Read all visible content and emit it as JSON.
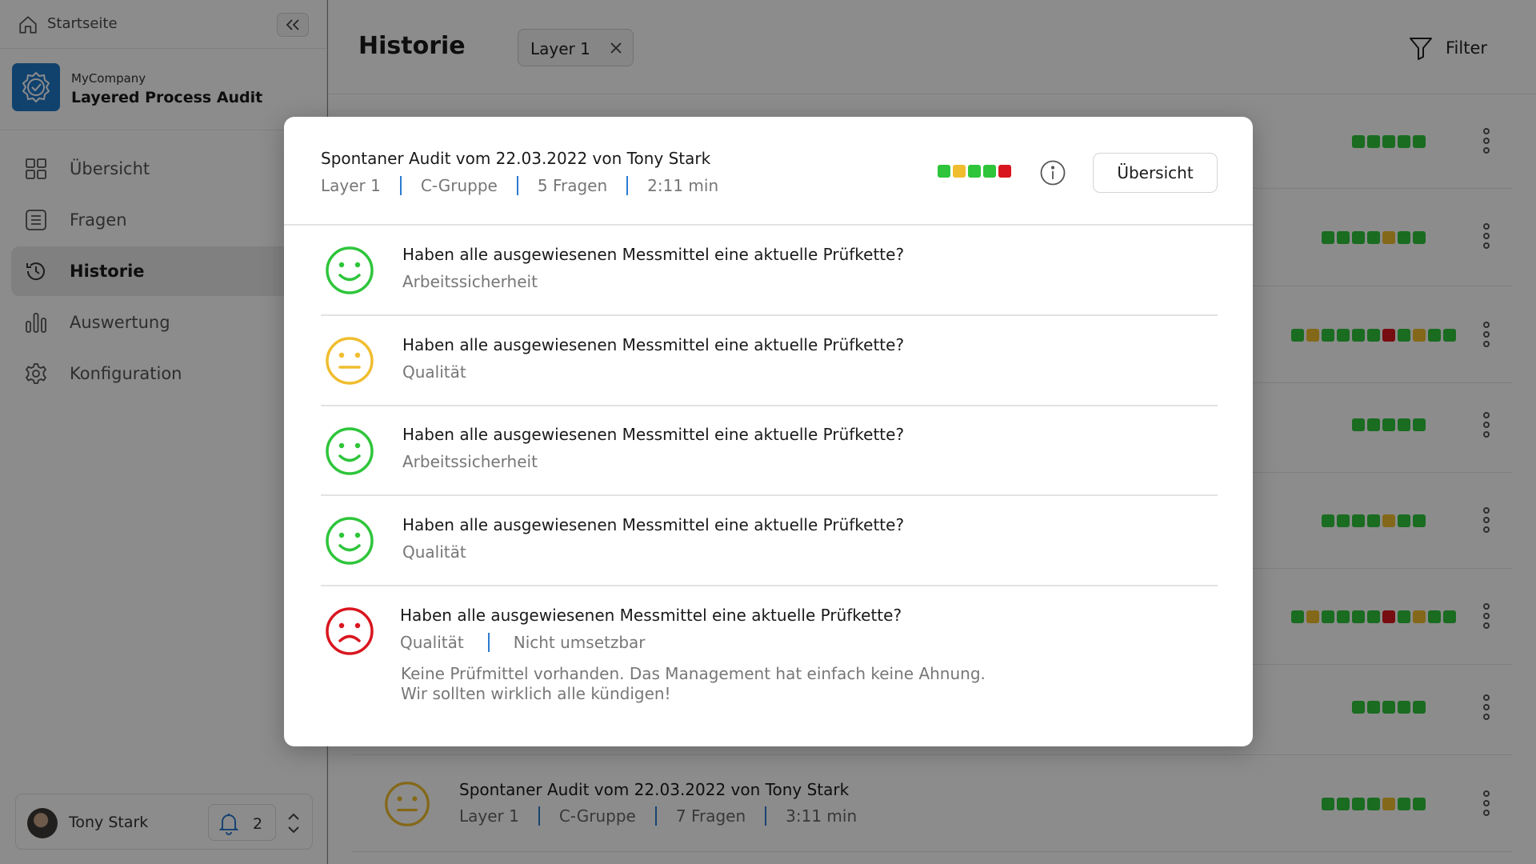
{
  "colors": {
    "green": "#2ec53b",
    "yellow": "#f0bd2f",
    "red": "#d9161f",
    "accent_blue": "#2b7bd0",
    "overlay": "rgba(0,0,0,0.45)"
  },
  "sidebar": {
    "home_label": "Startseite",
    "company": "MyCompany",
    "app_name": "Layered Process Audit",
    "nav": [
      {
        "label": "Übersicht",
        "icon": "grid-icon",
        "active": false
      },
      {
        "label": "Fragen",
        "icon": "list-icon",
        "active": false
      },
      {
        "label": "Historie",
        "icon": "history-icon",
        "active": true
      },
      {
        "label": "Auswertung",
        "icon": "bar-chart-icon",
        "active": false
      },
      {
        "label": "Konfiguration",
        "icon": "gear-icon",
        "active": false
      }
    ],
    "user": {
      "name": "Tony Stark",
      "notifications": "2"
    }
  },
  "header": {
    "title": "Historie",
    "chip_label": "Layer 1",
    "filter_label": "Filter"
  },
  "list": {
    "rows": [
      {
        "dots": [
          "green",
          "green",
          "green",
          "green",
          "green"
        ]
      },
      {
        "dots": [
          "green",
          "green",
          "green",
          "green",
          "yellow",
          "green",
          "green"
        ]
      },
      {
        "dots": [
          "green",
          "yellow",
          "green",
          "green",
          "green",
          "green",
          "red",
          "green",
          "yellow",
          "green",
          "green"
        ]
      },
      {
        "dots": [
          "green",
          "green",
          "green",
          "green",
          "green"
        ]
      },
      {
        "dots": [
          "green",
          "green",
          "green",
          "green",
          "yellow",
          "green",
          "green"
        ]
      },
      {
        "dots": [
          "green",
          "yellow",
          "green",
          "green",
          "green",
          "green",
          "red",
          "green",
          "yellow",
          "green",
          "green"
        ]
      },
      {
        "dots": [
          "green",
          "green",
          "green",
          "green",
          "green"
        ]
      },
      {
        "dots": [
          "green",
          "green",
          "green",
          "green",
          "yellow",
          "green",
          "green"
        ],
        "face": "neutral",
        "title": "Spontaner Audit vom 22.03.2022 von Tony Stark",
        "layer": "Layer 1",
        "group": "C-Gruppe",
        "questions": "7 Fragen",
        "duration": "3:11 min"
      }
    ]
  },
  "modal": {
    "title": "Spontaner Audit vom 22.03.2022 von Tony Stark",
    "layer": "Layer 1",
    "group": "C-Gruppe",
    "questions": "5 Fragen",
    "duration": "2:11 min",
    "dots": [
      "green",
      "yellow",
      "green",
      "green",
      "red"
    ],
    "overview_button": "Übersicht",
    "items": [
      {
        "face": "happy",
        "text": "Haben alle ausgewiesenen Messmittel eine aktuelle Prüfkette?",
        "category": "Arbeitssicherheit"
      },
      {
        "face": "neutral",
        "text": "Haben alle ausgewiesenen Messmittel eine aktuelle Prüfkette?",
        "category": "Qualität"
      },
      {
        "face": "happy",
        "text": "Haben alle ausgewiesenen Messmittel eine aktuelle Prüfkette?",
        "category": "Arbeitssicherheit"
      },
      {
        "face": "happy",
        "text": "Haben alle ausgewiesenen Messmittel eine aktuelle Prüfkette?",
        "category": "Qualität"
      },
      {
        "face": "sad",
        "text": "Haben alle ausgewiesenen Messmittel eine aktuelle Prüfkette?",
        "category": "Qualität",
        "status": "Nicht umsetzbar",
        "comment_line1": "Keine Prüfmittel vorhanden. Das Management hat einfach keine Ahnung.",
        "comment_line2": "Wir sollten wirklich alle kündigen!"
      }
    ]
  }
}
